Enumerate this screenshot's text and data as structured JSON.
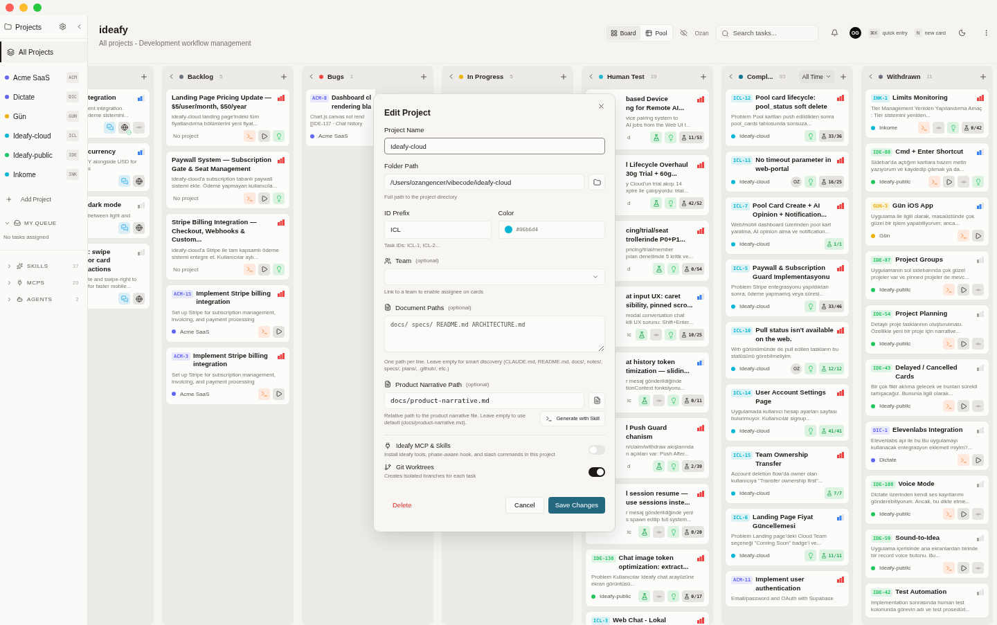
{
  "window": {
    "controls": [
      {
        "kind": "close"
      },
      {
        "kind": "minimize"
      },
      {
        "kind": "maximize"
      }
    ]
  },
  "sidebar": {
    "title": "Projects",
    "all_projects": {
      "label": "All Projects",
      "selected": true
    },
    "projects": [
      {
        "name": "Acme SaaS",
        "code": "ACM",
        "color": "#6366f1",
        "selected": false
      },
      {
        "name": "Dictate",
        "code": "DIC",
        "color": "#6366f1",
        "selected": false
      },
      {
        "name": "Gün",
        "code": "GUN",
        "color": "#eab308",
        "selected": false
      },
      {
        "name": "Ideafy-cloud",
        "code": "ICL",
        "color": "#06b6d4",
        "selected": false
      },
      {
        "name": "Ideafy-public",
        "code": "IDE",
        "color": "#22c55e",
        "selected": false
      },
      {
        "name": "Inkome",
        "code": "INK",
        "color": "#06b6d4",
        "selected": false
      }
    ],
    "add_project": "Add Project",
    "queue": {
      "label": "MY QUEUE",
      "expanded": true,
      "empty": "No tasks assigned"
    },
    "sections": [
      {
        "kind": "skills",
        "label": "SKILLS",
        "count": "37",
        "expanded": false
      },
      {
        "kind": "mcps",
        "label": "MCPS",
        "count": "20",
        "expanded": false
      },
      {
        "kind": "agents",
        "label": "AGENTS",
        "count": "2",
        "expanded": false
      }
    ]
  },
  "header": {
    "title": "ideafy",
    "subtitle": "All projects - Development workflow management",
    "views": [
      {
        "kind": "board",
        "label": "Board",
        "selected": true
      },
      {
        "kind": "pool",
        "label": "Pool",
        "selected": false
      }
    ],
    "user_filter": "Ozan",
    "search_placeholder": "Search tasks...",
    "avatar": "OG",
    "shortcuts": [
      {
        "key": "⌘K",
        "label": "quick entry"
      },
      {
        "key": "N",
        "label": "new card"
      }
    ]
  },
  "columns": [
    {
      "kind": "clipped",
      "cards": [
        {
          "kind": "clipped",
          "title": "tegration",
          "desc": "ent integration.\ndeme sistemini...",
          "priority": {
            "level": 0.67,
            "color": "#3b82f6"
          },
          "actions": [
            {
              "kind": "chat"
            },
            {
              "kind": "globe-check"
            },
            {
              "kind": "commit"
            }
          ]
        },
        {
          "kind": "clipped",
          "title": "currency",
          "desc": "Y alongside USD for\ns",
          "priority": {
            "level": 0.67,
            "color": "#3b82f6"
          },
          "actions": [
            {
              "kind": "chat"
            },
            {
              "kind": "globe"
            }
          ]
        },
        {
          "kind": "clipped",
          "title": "dark mode",
          "desc": "between light and",
          "priority": {
            "level": 0.33,
            "color": "#a8a29e"
          },
          "actions": [
            {
              "kind": "chat"
            },
            {
              "kind": "globe"
            }
          ]
        },
        {
          "kind": "clipped",
          "title": ": swipe\nor card actions",
          "desc": "te and swipe-right to\nfor faster mobile...",
          "priority": {
            "level": 0.33,
            "color": "#a8a29e"
          },
          "actions": [
            {
              "kind": "chat"
            },
            {
              "kind": "globe"
            }
          ]
        }
      ]
    },
    {
      "kind": "normal",
      "title": "Backlog",
      "count": "5",
      "color": "#6b7280",
      "cards": [
        {
          "kind": "full",
          "title": "Landing Page Pricing Update — $5/user/month, $50/year",
          "desc": "ideafy-cloud landing page'indeki tüm fiyatlandırma bölümlerini yeni fiyat...",
          "project": "No project",
          "priority": {
            "level": 1,
            "color": "#ef4444"
          },
          "actions": [
            {
              "kind": "terminal"
            },
            {
              "kind": "play"
            },
            {
              "kind": "idea"
            }
          ]
        },
        {
          "kind": "full",
          "title": "Paywall System — Subscription Gate & Seat Management",
          "desc": "ideafy-cloud'a subscription tabanlı paywall sistemi ekle. Ödeme yapmayan kullanıcıla...",
          "project": "No project",
          "priority": {
            "level": 1,
            "color": "#ef4444"
          },
          "actions": [
            {
              "kind": "terminal"
            },
            {
              "kind": "play"
            },
            {
              "kind": "idea"
            }
          ]
        },
        {
          "kind": "full",
          "title": "Stripe Billing Integration — Checkout, Webhooks & Custom...",
          "desc": "ideafy-cloud'a Stripe ile tam kapsamlı ödeme sistemi entegre et. Kullanıcılar aylı...",
          "project": "No project",
          "priority": {
            "level": 1,
            "color": "#ef4444"
          },
          "actions": [
            {
              "kind": "terminal"
            },
            {
              "kind": "play"
            },
            {
              "kind": "idea"
            }
          ]
        },
        {
          "kind": "full",
          "id": "ACM-15",
          "title": "Implement Stripe billing integration",
          "desc": "Set up Stripe for subscription management, invoicing, and payment processing",
          "project": "Acme SaaS",
          "color": "#6366f1",
          "priority": {
            "level": 1,
            "color": "#ef4444"
          },
          "actions": [
            {
              "kind": "terminal"
            },
            {
              "kind": "play"
            }
          ]
        },
        {
          "kind": "full",
          "id": "ACM-3",
          "title": "Implement Stripe billing integration",
          "desc": "Set up Stripe for subscription management, invoicing, and payment processing",
          "project": "Acme SaaS",
          "color": "#6366f1",
          "priority": {
            "level": 1,
            "color": "#ef4444"
          },
          "actions": [
            {
              "kind": "terminal"
            },
            {
              "kind": "play"
            }
          ]
        }
      ]
    },
    {
      "kind": "normal",
      "title": "Bugs",
      "count": "1",
      "color": "#ef4444",
      "cards": [
        {
          "kind": "covered-right",
          "id": "ACM-8",
          "title": "Dashboard cl\nrendering bla",
          "desc": "Chart.js canvas not rend\n[[IDE-137 · Chat history",
          "project": "Acme SaaS",
          "color": "#6366f1"
        }
      ]
    },
    {
      "kind": "normal",
      "title": "In Progress",
      "count": "5",
      "color": "#eab308"
    },
    {
      "kind": "normal",
      "title": "Human Test",
      "count": "19",
      "color": "#22b8cf",
      "cards": [
        {
          "kind": "covered",
          "title": "based Device\nng for Remote AI...",
          "desc": "vice pairing system to\nAI jobs from the Web UI t...",
          "project": "d",
          "priority": {
            "level": 1,
            "color": "#ef4444"
          },
          "actions": [
            {
              "kind": "test"
            },
            {
              "kind": "idea"
            },
            {
              "kind": "progress",
              "text": "11/53",
              "complete": false
            }
          ]
        },
        {
          "kind": "covered",
          "title": "l Lifecycle Overhaul\n30g Trial + 60g...",
          "desc": "y Cloud'un trial akışı 14\nxpire ile çalışıyordu: trial...",
          "project": "d",
          "priority": {
            "level": 1,
            "color": "#ef4444"
          },
          "actions": [
            {
              "kind": "test"
            },
            {
              "kind": "idea"
            },
            {
              "kind": "progress",
              "text": "42/52",
              "complete": false
            }
          ]
        },
        {
          "kind": "covered",
          "title": "cing/trial/seat\ntrollerinde P0+P1...",
          "desc": "pricing/trial/member\npılan denetimde 5 kritik ve...",
          "project": "d",
          "priority": {
            "level": 1,
            "color": "#ef4444"
          },
          "actions": [
            {
              "kind": "test"
            },
            {
              "kind": "idea"
            },
            {
              "kind": "progress",
              "text": "0/54",
              "complete": false
            }
          ]
        },
        {
          "kind": "covered",
          "title": "at input UX: caret\nsibility, pinned scro...",
          "desc": "modal conversation chat\nkili UX sorunu: Shift+Enter...",
          "project": "ic",
          "priority": {
            "level": 0.67,
            "color": "#3b82f6"
          },
          "actions": [
            {
              "kind": "test"
            },
            {
              "kind": "commit"
            },
            {
              "kind": "idea"
            },
            {
              "kind": "progress",
              "text": "10/25",
              "complete": false
            }
          ]
        },
        {
          "kind": "covered",
          "title": "at history token\ntimization — slidin...",
          "desc": "r mesaj gönderildiğinde\ntionContext fonksiyonu...",
          "project": "ic",
          "priority": {
            "level": 0.67,
            "color": "#3b82f6"
          },
          "actions": [
            {
              "kind": "test"
            },
            {
              "kind": "commit"
            },
            {
              "kind": "idea"
            },
            {
              "kind": "progress",
              "text": "0/11",
              "complete": false
            }
          ]
        },
        {
          "kind": "covered",
          "title": "l Push Guard\nchanism",
          "desc": "n/claim/withdraw akışlarında\nn açıkları var: Push After...",
          "project": "d",
          "priority": {
            "level": 1,
            "color": "#ef4444"
          },
          "actions": [
            {
              "kind": "test"
            },
            {
              "kind": "idea"
            },
            {
              "kind": "progress",
              "text": "2/39",
              "complete": false
            }
          ]
        },
        {
          "kind": "covered",
          "title": "l session resume —\nuse sessions inste...",
          "desc": "r mesaj gönderildiğinde yeni\ns spawn edilip full system...",
          "project": "ic",
          "priority": {
            "level": 1,
            "color": "#ef4444"
          },
          "actions": [
            {
              "kind": "test"
            },
            {
              "kind": "commit"
            },
            {
              "kind": "idea"
            },
            {
              "kind": "progress",
              "text": "0/20",
              "complete": false
            }
          ]
        },
        {
          "kind": "full",
          "id": "IDE-138",
          "title": "Chat image token optimization: extract...",
          "desc": "Problem Kullanıcılar Ideafy chat arayüzüne ekran görüntüsü...",
          "project": "Ideafy-public",
          "color": "#22c55e",
          "priority": {
            "level": 1,
            "color": "#ef4444"
          },
          "actions": [
            {
              "kind": "test"
            },
            {
              "kind": "commit"
            },
            {
              "kind": "idea"
            },
            {
              "kind": "progress",
              "text": "0/17",
              "complete": false
            }
          ]
        },
        {
          "kind": "full",
          "id": "ICL-3",
          "title": "Web Chat - Lokal",
          "priority": {
            "level": 1,
            "color": "#ef4444"
          },
          "color": "#06b6d4"
        }
      ]
    },
    {
      "kind": "normal",
      "title": "Compl...",
      "count": "93",
      "color": "#0e7490",
      "filter": "All Time",
      "cards": [
        {
          "kind": "full",
          "id": "ICL-12",
          "title": "Pool card lifecycle: pool_status soft delete",
          "desc": "Problem Pool kartları push edildikten sonra pool_cards tablosunda sonsuza...",
          "project": "Ideafy-cloud",
          "color": "#06b6d4",
          "priority": {
            "level": 1,
            "color": "#ef4444"
          },
          "actions": [
            {
              "kind": "idea"
            },
            {
              "kind": "progress",
              "text": "33/36",
              "complete": false
            }
          ]
        },
        {
          "kind": "full",
          "id": "ICL-11",
          "title": "No timeout parameter in web-portal",
          "project": "Ideafy-cloud",
          "color": "#06b6d4",
          "priority": {
            "level": 1,
            "color": "#ef4444"
          },
          "actions": [
            {
              "kind": "avatar",
              "text": "OZ"
            },
            {
              "kind": "idea"
            },
            {
              "kind": "progress",
              "text": "16/25",
              "complete": false
            }
          ]
        },
        {
          "kind": "full",
          "id": "ICL-7",
          "title": "Pool Card Create + AI Opinion + Notification...",
          "desc": "Web/mobil dashboard üzerinden pool kart yaratma, AI opinion alma ve notification...",
          "project": "Ideafy-cloud",
          "color": "#06b6d4",
          "priority": {
            "level": 1,
            "color": "#ef4444"
          },
          "actions": [
            {
              "kind": "progress",
              "text": "1/1",
              "complete": true
            }
          ]
        },
        {
          "kind": "full",
          "id": "ICL-5",
          "title": "Paywall & Subscription Guard Implementasyonu",
          "desc": "Problem Stripe entegrasyonu yapıldıktan sonra, ödeme yapmamış veya süresi...",
          "project": "Ideafy-cloud",
          "color": "#06b6d4",
          "priority": {
            "level": 1,
            "color": "#ef4444"
          },
          "actions": [
            {
              "kind": "idea"
            },
            {
              "kind": "progress",
              "text": "33/46",
              "complete": false
            }
          ]
        },
        {
          "kind": "full",
          "id": "ICL-10",
          "title": "Pull status isn't available on the web.",
          "desc": "Wrb görünümünde de pull edilen taskların bu statüsünü görebilmeliyim.",
          "project": "Ideafy-cloud",
          "color": "#06b6d4",
          "priority": {
            "level": 1,
            "color": "#ef4444"
          },
          "actions": [
            {
              "kind": "avatar",
              "text": "OZ"
            },
            {
              "kind": "idea"
            },
            {
              "kind": "progress",
              "text": "12/12",
              "complete": true
            }
          ]
        },
        {
          "kind": "full",
          "id": "ICL-14",
          "title": "User Account Settings Page",
          "desc": "Uygulamada kullanıcı hesap ayarları sayfası bulunmuyor. Kullanıcılar signup...",
          "project": "Ideafy-cloud",
          "color": "#06b6d4",
          "priority": {
            "level": 1,
            "color": "#ef4444"
          },
          "actions": [
            {
              "kind": "idea"
            },
            {
              "kind": "progress",
              "text": "41/41",
              "complete": true
            }
          ]
        },
        {
          "kind": "full",
          "id": "ICL-15",
          "title": "Team Ownership Transfer",
          "desc": "Account deletion flow'da owner olan kullanıcıya \"Transfer ownership first\"...",
          "project": "Ideafy-cloud",
          "color": "#06b6d4",
          "priority": {
            "level": 1,
            "color": "#ef4444"
          },
          "actions": [
            {
              "kind": "progress",
              "text": "7/7",
              "complete": true
            }
          ]
        },
        {
          "kind": "full",
          "id": "ICL-6",
          "title": "Landing Page Fiyat Güncellemesi",
          "desc": "Problem Landing page'deki Cloud Team seçeneği \"Coming Soon\" badge'i ve...",
          "project": "Ideafy-cloud",
          "color": "#06b6d4",
          "priority": {
            "level": 0.67,
            "color": "#3b82f6"
          },
          "actions": [
            {
              "kind": "idea"
            },
            {
              "kind": "progress",
              "text": "11/11",
              "complete": true
            }
          ]
        },
        {
          "kind": "full",
          "id": "ACM-11",
          "title": "Implement user authentication",
          "desc": "Email/password and OAuth with Supabase",
          "color": "#6366f1",
          "priority": {
            "level": 1,
            "color": "#ef4444"
          }
        }
      ]
    },
    {
      "kind": "normal",
      "title": "Withdrawn",
      "count": "11",
      "color": "#6b7280",
      "cards": [
        {
          "kind": "full",
          "id": "INK-1",
          "title": "Limits Monitoring",
          "desc": "Tier Management Yeniden Yapılandırma Amaç : Tier sistemini yeniden...",
          "project": "Inkome",
          "color": "#06b6d4",
          "priority": {
            "level": 1,
            "color": "#ef4444"
          },
          "actions": [
            {
              "kind": "terminal"
            },
            {
              "kind": "commit"
            },
            {
              "kind": "idea"
            },
            {
              "kind": "progress",
              "text": "0/42",
              "complete": false
            }
          ]
        },
        {
          "kind": "full",
          "id": "IDE-88",
          "title": "Cmd + Enter Shortcut",
          "desc": "Sidebar'da açtığım kartlara bazen metin yazıyorum ve kaydedip çıkmak ya da...",
          "project": "Ideafy-public",
          "color": "#22c55e",
          "priority": {
            "level": 0.67,
            "color": "#3b82f6"
          },
          "actions": [
            {
              "kind": "terminal"
            },
            {
              "kind": "play"
            },
            {
              "kind": "commit"
            },
            {
              "kind": "idea"
            }
          ]
        },
        {
          "kind": "full",
          "id": "GUN-3",
          "title": "Gün iOS App",
          "desc": "Uygulama ile ilgili olarak, masaüstünde çok güzel bir işlem yapabiliyorum; anca...",
          "project": "Gün",
          "color": "#eab308",
          "priority": {
            "level": 0.67,
            "color": "#3b82f6"
          },
          "actions": [
            {
              "kind": "terminal"
            },
            {
              "kind": "play"
            }
          ]
        },
        {
          "kind": "full",
          "id": "IDE-87",
          "title": "Project Groups",
          "desc": "Uygulamanın sol sidebarında çok güzel projeler var ve pinned projeler de mevc...",
          "project": "Ideafy-public",
          "color": "#22c55e",
          "priority": {
            "level": 0.33,
            "color": "#a8a29e"
          },
          "actions": [
            {
              "kind": "terminal"
            },
            {
              "kind": "play"
            },
            {
              "kind": "commit"
            }
          ]
        },
        {
          "kind": "full",
          "id": "IDE-54",
          "title": "Project Planning",
          "desc": "Detaylı proje tasklarının oluşturulması. Özellikle yeni bir proje için narrative...",
          "project": "Ideafy-public",
          "color": "#22c55e",
          "priority": {
            "level": 0.33,
            "color": "#a8a29e"
          },
          "actions": [
            {
              "kind": "terminal"
            },
            {
              "kind": "play"
            },
            {
              "kind": "commit"
            }
          ]
        },
        {
          "kind": "full",
          "id": "IDE-43",
          "title": "Delayed / Cancelled Cards",
          "desc": "Bir çok fikir aklıma gelecek ve bunları sürekli tartışacağız. Bununla ilgili olarak...",
          "project": "Ideafy-public",
          "color": "#22c55e",
          "priority": {
            "level": 0.33,
            "color": "#a8a29e"
          },
          "actions": [
            {
              "kind": "terminal"
            },
            {
              "kind": "play"
            },
            {
              "kind": "commit"
            }
          ]
        },
        {
          "kind": "full",
          "id": "DIC-1",
          "title": "Elevenlabs Integration",
          "desc": "Elevenlabs api ile bu Bu uygulamayı kullanacak entegrasyon eklemeli miyim?...",
          "project": "Dictate",
          "color": "#6366f1",
          "priority": {
            "level": 0.33,
            "color": "#a8a29e"
          },
          "actions": [
            {
              "kind": "terminal"
            },
            {
              "kind": "play"
            }
          ]
        },
        {
          "kind": "full",
          "id": "IDE-108",
          "title": "Voice Mode",
          "desc": "Dictate üzerinden kendi ses kayıtlarımı gönderebiliyorum. Ancak, bu dikte etme...",
          "project": "Ideafy-public",
          "color": "#22c55e",
          "priority": {
            "level": 0.33,
            "color": "#a8a29e"
          },
          "actions": [
            {
              "kind": "terminal"
            },
            {
              "kind": "play"
            },
            {
              "kind": "commit"
            }
          ]
        },
        {
          "kind": "full",
          "id": "IDE-59",
          "title": "Sound-to-Idea",
          "desc": "Uygulama içerisinde ana ekranlardan birinde bir record voice butonu. Bu...",
          "project": "Ideafy-public",
          "color": "#22c55e",
          "priority": {
            "level": 0.33,
            "color": "#a8a29e"
          },
          "actions": [
            {
              "kind": "terminal"
            },
            {
              "kind": "play"
            },
            {
              "kind": "commit"
            }
          ]
        },
        {
          "kind": "full",
          "id": "IDE-42",
          "title": "Test Automation",
          "desc": "Implementation sonrasında human test kolonunda görevin adı ve test prosedürl...",
          "color": "#22c55e",
          "priority": {
            "level": 0.33,
            "color": "#a8a29e"
          }
        }
      ]
    }
  ],
  "modal": {
    "title": "Edit Project",
    "project_name": {
      "label": "Project Name",
      "value": "Ideafy-cloud"
    },
    "folder_path": {
      "label": "Folder Path",
      "value": "/Users/ozangencer/vibecode/ideafy-cloud",
      "hint": "Full path to the project directory"
    },
    "id_prefix": {
      "label": "ID Prefix",
      "value": "ICL",
      "hint": "Task IDs: ICL-1, ICL-2..."
    },
    "color": {
      "label": "Color",
      "value": "#06b6d4"
    },
    "team": {
      "label": "Team",
      "optional": "(optional)",
      "hint": "Link to a team to enable assignee on cards"
    },
    "document_paths": {
      "label": "Document Paths",
      "optional": "(optional)",
      "placeholder": "docs/ specs/ README.md ARCHITECTURE.md",
      "hint": "One path per line. Leave empty for smart discovery (CLAUDE.md, README.md, docs/, notes/, specs/, plans/, .github/, etc.)"
    },
    "narrative": {
      "label": "Product Narrative Path",
      "optional": "(optional)",
      "value": "docs/product-narrative.md",
      "hint": "Relative path to the product narrative file. Leave empty to use default (docs/product-narrative.md).",
      "action": "Generate with Skill"
    },
    "toggles": [
      {
        "kind": "mcp",
        "label": "Ideafy MCP & Skills",
        "hint": "Install ideafy tools, phase-aware hook, and slash commands in this project",
        "on": false
      },
      {
        "kind": "worktrees",
        "label": "Git Worktrees",
        "hint": "Creates isolated branches for each task",
        "on": true
      }
    ],
    "delete": "Delete",
    "cancel": "Cancel",
    "save": "Save Changes"
  }
}
